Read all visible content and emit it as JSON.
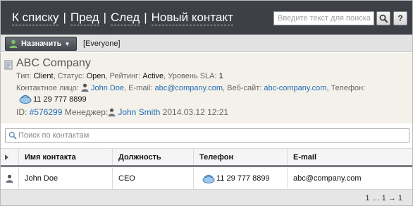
{
  "nav": {
    "back_label": "К списку",
    "prev_label": "Пред",
    "next_label": "След",
    "new_contact_label": "Новый контакт",
    "separator": "|"
  },
  "search": {
    "placeholder": "Введите текст для поиска",
    "help_label": "?"
  },
  "toolbar": {
    "assign_label": "Назначить",
    "assigned_group": "[Everyone]"
  },
  "company": {
    "name": "ABC Company",
    "type_label": "Тип:",
    "type_value": "Client",
    "status_label": "Статус:",
    "status_value": "Open",
    "rating_label": "Рейтинг:",
    "rating_value": "Active",
    "sla_label": "Уровень SLA:",
    "sla_value": "1",
    "contact_label": "Контактное лицо:",
    "contact_value": "John Doe",
    "email_label": "E-mail:",
    "email_value": "abc@company.com",
    "website_label": "Веб-сайт:",
    "website_value": "abc-company.com",
    "phone_label": "Телефон:",
    "phone_value": "11 29 777 8899",
    "id_label": "ID:",
    "id_value": "#576299",
    "manager_label": "Менеджер:",
    "manager_value": "John Smith",
    "timestamp": "2014.03.12 12:21"
  },
  "contact_search": {
    "placeholder": "Поиск по контактам"
  },
  "table": {
    "headers": {
      "name": "Имя контакта",
      "position": "Должность",
      "phone": "Телефон",
      "email": "E-mail"
    },
    "rows": [
      {
        "name": "John Doe",
        "position": "CEO",
        "phone": "11 29 777 8899",
        "email": "abc@company.com"
      }
    ]
  },
  "pager": {
    "text": "1 … 1 → 1"
  },
  "colors": {
    "topbar": "#3d4147",
    "link": "#1f6bb3",
    "details_bg": "#f3f1ea"
  },
  "icons": [
    "person-icon",
    "company-icon",
    "phone-icon",
    "search-icon",
    "help-icon",
    "chevron-down-icon",
    "expand-triangle-icon"
  ]
}
